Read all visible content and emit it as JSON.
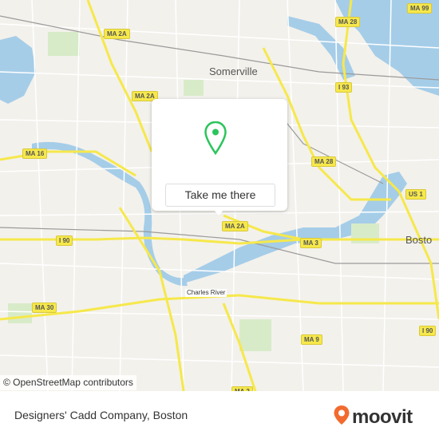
{
  "map": {
    "city_labels": [
      "Somerville",
      "Bosto"
    ],
    "route_shields": [
      "MA 28",
      "MA 99",
      "MA 2A",
      "MA 2A",
      "I 93",
      "MA 16",
      "MA 28",
      "US 1",
      "MA 2A",
      "MA 3",
      "I 90",
      "MA 30",
      "MA 9",
      "I 90",
      "MA 2"
    ],
    "river_label": "Charles River",
    "attribution": "© OpenStreetMap contributors",
    "colors": {
      "land": "#f3f1ec",
      "water": "#a5cde8",
      "park": "#d8ebc9",
      "major_road": "#f6e84b",
      "minor_road": "#ffffff",
      "rail": "#9a9a9a",
      "accent": "#2bc45c"
    }
  },
  "popup": {
    "button_label": "Take me there",
    "pin_icon": "map-pin-icon"
  },
  "footer": {
    "place_name": "Designers' Cadd Company, Boston",
    "brand": "moovit",
    "brand_color": "#f26a2e"
  }
}
